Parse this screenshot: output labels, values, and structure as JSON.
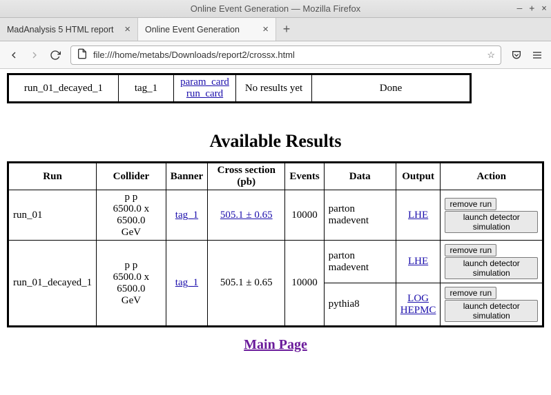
{
  "window": {
    "title": "Online Event Generation — Mozilla Firefox"
  },
  "tabs": {
    "inactive": "MadAnalysis 5 HTML report",
    "active": "Online Event Generation"
  },
  "url": "file:///home/metabs/Downloads/report2/crossx.html",
  "top_row": {
    "run": "run_01_decayed_1",
    "tag": "tag_1",
    "card1": "param_card",
    "card2": "run_card",
    "results": "No results yet",
    "status": "Done"
  },
  "section_title": "Available Results",
  "headers": {
    "run": "Run",
    "collider": "Collider",
    "banner": "Banner",
    "cross": "Cross section (pb)",
    "events": "Events",
    "data": "Data",
    "output": "Output",
    "action": "Action"
  },
  "collider": {
    "line1": "p p",
    "line2": "6500.0 x 6500.0",
    "line3": "GeV"
  },
  "row1": {
    "run": "run_01",
    "banner": "tag_1",
    "cross": "505.1 ± 0.65",
    "events": "10000",
    "data": "parton madevent",
    "output": "LHE"
  },
  "row2": {
    "run": "run_01_decayed_1",
    "banner": "tag_1",
    "cross": "505.1 ± 0.65",
    "events": "10000",
    "sub1": {
      "data": "parton madevent",
      "output": "LHE"
    },
    "sub2": {
      "data": "pythia8",
      "out1": "LOG",
      "out2": "HEPMC"
    }
  },
  "actions": {
    "remove": "remove run",
    "launch": "launch detector simulation"
  },
  "main_page": "Main Page"
}
